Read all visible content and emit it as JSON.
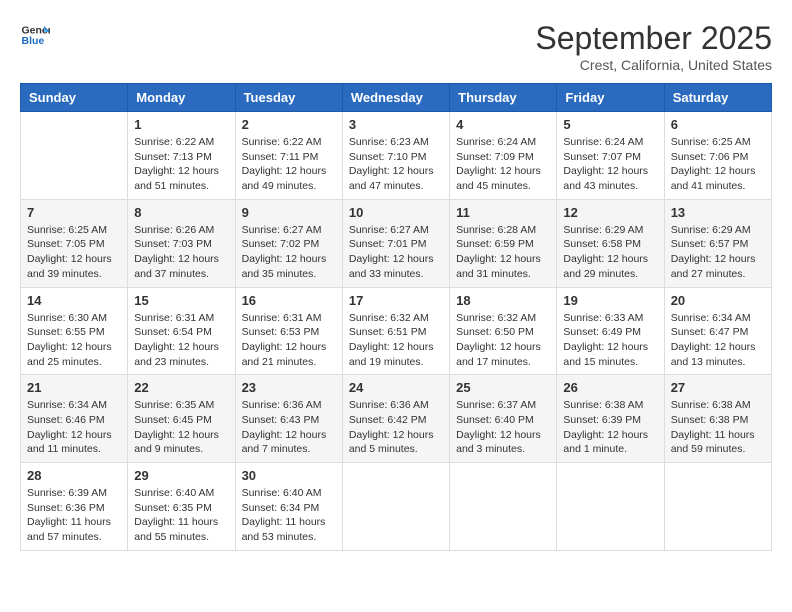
{
  "header": {
    "logo_general": "General",
    "logo_blue": "Blue",
    "month_title": "September 2025",
    "location": "Crest, California, United States"
  },
  "weekdays": [
    "Sunday",
    "Monday",
    "Tuesday",
    "Wednesday",
    "Thursday",
    "Friday",
    "Saturday"
  ],
  "weeks": [
    [
      {
        "day": "",
        "info": ""
      },
      {
        "day": "1",
        "info": "Sunrise: 6:22 AM\nSunset: 7:13 PM\nDaylight: 12 hours\nand 51 minutes."
      },
      {
        "day": "2",
        "info": "Sunrise: 6:22 AM\nSunset: 7:11 PM\nDaylight: 12 hours\nand 49 minutes."
      },
      {
        "day": "3",
        "info": "Sunrise: 6:23 AM\nSunset: 7:10 PM\nDaylight: 12 hours\nand 47 minutes."
      },
      {
        "day": "4",
        "info": "Sunrise: 6:24 AM\nSunset: 7:09 PM\nDaylight: 12 hours\nand 45 minutes."
      },
      {
        "day": "5",
        "info": "Sunrise: 6:24 AM\nSunset: 7:07 PM\nDaylight: 12 hours\nand 43 minutes."
      },
      {
        "day": "6",
        "info": "Sunrise: 6:25 AM\nSunset: 7:06 PM\nDaylight: 12 hours\nand 41 minutes."
      }
    ],
    [
      {
        "day": "7",
        "info": "Sunrise: 6:25 AM\nSunset: 7:05 PM\nDaylight: 12 hours\nand 39 minutes."
      },
      {
        "day": "8",
        "info": "Sunrise: 6:26 AM\nSunset: 7:03 PM\nDaylight: 12 hours\nand 37 minutes."
      },
      {
        "day": "9",
        "info": "Sunrise: 6:27 AM\nSunset: 7:02 PM\nDaylight: 12 hours\nand 35 minutes."
      },
      {
        "day": "10",
        "info": "Sunrise: 6:27 AM\nSunset: 7:01 PM\nDaylight: 12 hours\nand 33 minutes."
      },
      {
        "day": "11",
        "info": "Sunrise: 6:28 AM\nSunset: 6:59 PM\nDaylight: 12 hours\nand 31 minutes."
      },
      {
        "day": "12",
        "info": "Sunrise: 6:29 AM\nSunset: 6:58 PM\nDaylight: 12 hours\nand 29 minutes."
      },
      {
        "day": "13",
        "info": "Sunrise: 6:29 AM\nSunset: 6:57 PM\nDaylight: 12 hours\nand 27 minutes."
      }
    ],
    [
      {
        "day": "14",
        "info": "Sunrise: 6:30 AM\nSunset: 6:55 PM\nDaylight: 12 hours\nand 25 minutes."
      },
      {
        "day": "15",
        "info": "Sunrise: 6:31 AM\nSunset: 6:54 PM\nDaylight: 12 hours\nand 23 minutes."
      },
      {
        "day": "16",
        "info": "Sunrise: 6:31 AM\nSunset: 6:53 PM\nDaylight: 12 hours\nand 21 minutes."
      },
      {
        "day": "17",
        "info": "Sunrise: 6:32 AM\nSunset: 6:51 PM\nDaylight: 12 hours\nand 19 minutes."
      },
      {
        "day": "18",
        "info": "Sunrise: 6:32 AM\nSunset: 6:50 PM\nDaylight: 12 hours\nand 17 minutes."
      },
      {
        "day": "19",
        "info": "Sunrise: 6:33 AM\nSunset: 6:49 PM\nDaylight: 12 hours\nand 15 minutes."
      },
      {
        "day": "20",
        "info": "Sunrise: 6:34 AM\nSunset: 6:47 PM\nDaylight: 12 hours\nand 13 minutes."
      }
    ],
    [
      {
        "day": "21",
        "info": "Sunrise: 6:34 AM\nSunset: 6:46 PM\nDaylight: 12 hours\nand 11 minutes."
      },
      {
        "day": "22",
        "info": "Sunrise: 6:35 AM\nSunset: 6:45 PM\nDaylight: 12 hours\nand 9 minutes."
      },
      {
        "day": "23",
        "info": "Sunrise: 6:36 AM\nSunset: 6:43 PM\nDaylight: 12 hours\nand 7 minutes."
      },
      {
        "day": "24",
        "info": "Sunrise: 6:36 AM\nSunset: 6:42 PM\nDaylight: 12 hours\nand 5 minutes."
      },
      {
        "day": "25",
        "info": "Sunrise: 6:37 AM\nSunset: 6:40 PM\nDaylight: 12 hours\nand 3 minutes."
      },
      {
        "day": "26",
        "info": "Sunrise: 6:38 AM\nSunset: 6:39 PM\nDaylight: 12 hours\nand 1 minute."
      },
      {
        "day": "27",
        "info": "Sunrise: 6:38 AM\nSunset: 6:38 PM\nDaylight: 11 hours\nand 59 minutes."
      }
    ],
    [
      {
        "day": "28",
        "info": "Sunrise: 6:39 AM\nSunset: 6:36 PM\nDaylight: 11 hours\nand 57 minutes."
      },
      {
        "day": "29",
        "info": "Sunrise: 6:40 AM\nSunset: 6:35 PM\nDaylight: 11 hours\nand 55 minutes."
      },
      {
        "day": "30",
        "info": "Sunrise: 6:40 AM\nSunset: 6:34 PM\nDaylight: 11 hours\nand 53 minutes."
      },
      {
        "day": "",
        "info": ""
      },
      {
        "day": "",
        "info": ""
      },
      {
        "day": "",
        "info": ""
      },
      {
        "day": "",
        "info": ""
      }
    ]
  ]
}
